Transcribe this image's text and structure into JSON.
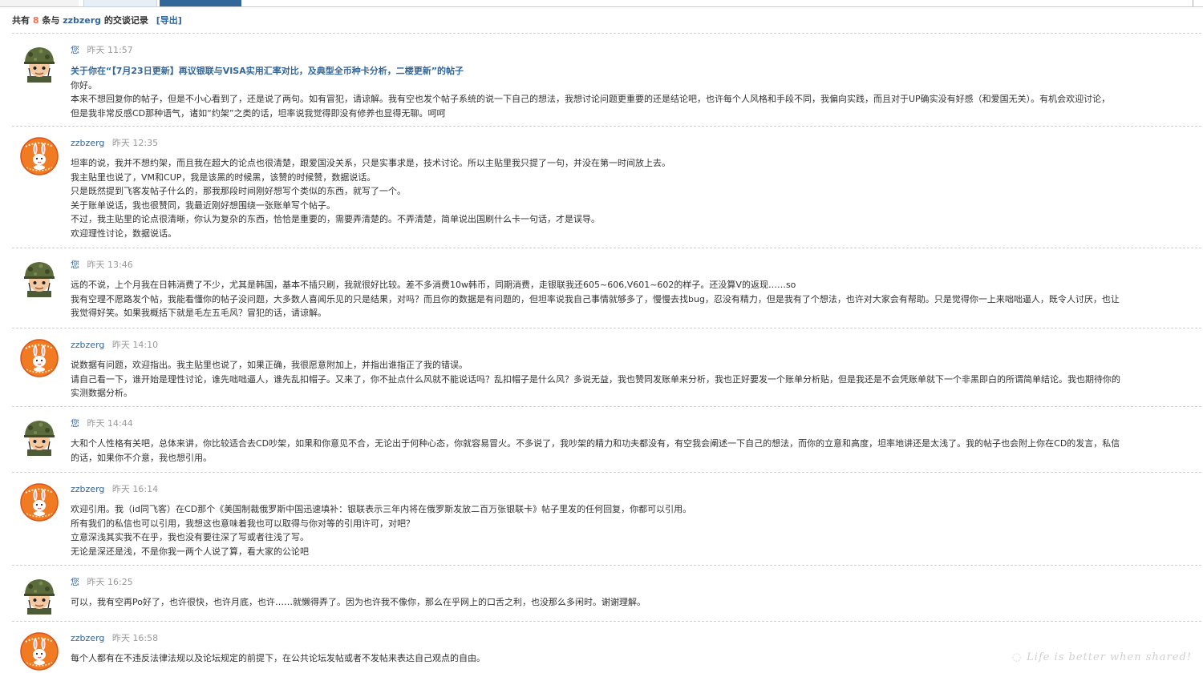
{
  "summary": {
    "prefix": "共有",
    "count": "8",
    "mid": "条与",
    "user": "zzbzerg",
    "suffix": "的交谈记录",
    "export": "[导出]"
  },
  "messages": [
    {
      "author": "您",
      "time": "昨天 11:57",
      "avatar": "soldier-avatar",
      "thread_title": "关于你在“【7月23日更新】再议银联与VISA实用汇率对比，及典型全币种卡分析，二楼更新”的帖子",
      "lines": [
        "你好。",
        "本来不想回复你的帖子，但是不小心看到了，还是说了两句。如有冒犯，请谅解。我有空也发个帖子系统的说一下自己的想法，我想讨论问题更重要的还是结论吧，也许每个人风格和手段不同，我偏向实践，而且对于UP确实没有好感（和爱国无关）。有机会欢迎讨论，",
        "但是我非常反感CD那种语气，诸如“约架”之类的话，坦率说我觉得即没有修养也显得无聊。呵呵"
      ]
    },
    {
      "author": "zzbzerg",
      "time": "昨天 12:35",
      "avatar": "rabbit-avatar",
      "lines": [
        "坦率的说，我并不想约架，而且我在超大的论点也很清楚，跟爱国没关系，只是实事求是，技术讨论。所以主贴里我只提了一句，并没在第一时间放上去。",
        "我主贴里也说了，VM和CUP，我是该黑的时候黑，该赞的时候赞，数据说话。",
        "只是既然提到飞客发帖子什么的，那我那段时间刚好想写个类似的东西，就写了一个。",
        "关于账单说话，我也很赞同，我最近刚好想围绕一张账单写个帖子。",
        "不过，我主贴里的论点很清晰，你认为复杂的东西，恰恰是重要的，需要弄清楚的。不弄清楚，简单说出国刷什么卡一句话，才是误导。",
        "欢迎理性讨论，数据说话。"
      ]
    },
    {
      "author": "您",
      "time": "昨天 13:46",
      "avatar": "soldier-avatar",
      "lines": [
        "远的不说，上个月我在日韩消费了不少，尤其是韩国，基本不插只刷，我就很好比较。差不多消费10w韩币，同期消费，走银联我还605~606,V601~602的样子。还没算V的返现……so",
        "我有空理不愿路发个帖，我能看懂你的帖子没问题，大多数人喜闻乐见的只是结果，对吗？而且你的数据是有问题的，但坦率说我自己事情就够多了，慢慢去找bug，忍没有精力，但是我有了个想法，也许对大家会有帮助。只是觉得你一上来咄咄逼人，既令人讨厌，也让",
        "我觉得好笑。如果我概括下就是毛左五毛风？冒犯的话，请谅解。"
      ]
    },
    {
      "author": "zzbzerg",
      "time": "昨天 14:10",
      "avatar": "rabbit-avatar",
      "lines": [
        "说数据有问题，欢迎指出。我主贴里也说了，如果正确，我很愿意附加上，并指出谁指正了我的错误。",
        "请自己看一下，谁开始是理性讨论，谁先咄咄逼人，谁先乱扣帽子。又来了，你不扯点什么风就不能说话吗？乱扣帽子是什么风？多说无益，我也赞同发账单来分析，我也正好要发一个账单分析贴，但是我还是不会凭账单就下一个非黑即白的所谓简单结论。我也期待你的",
        "实测数据分析。"
      ]
    },
    {
      "author": "您",
      "time": "昨天 14:44",
      "avatar": "soldier-avatar",
      "lines": [
        "大和个人性格有关吧，总体来讲，你比较适合去CD吵架，如果和你意见不合，无论出于何种心态，你就容易冒火。不多说了，我吵架的精力和功夫都没有，有空我会阐述一下自己的想法，而你的立意和高度，坦率地讲还是太浅了。我的帖子也会附上你在CD的发言，私信",
        "的话，如果你不介意，我也想引用。"
      ]
    },
    {
      "author": "zzbzerg",
      "time": "昨天 16:14",
      "avatar": "rabbit-avatar",
      "lines": [
        "欢迎引用。我（id同飞客）在CD那个《美国制裁俄罗斯中国迅速填补：银联表示三年内将在俄罗斯发放二百万张银联卡》帖子里发的任何回复，你都可以引用。",
        "所有我们的私信也可以引用，我想这也意味着我也可以取得与你对等的引用许可，对吧？",
        "立意深浅其实我不在乎，我也没有要往深了写或者往浅了写。",
        "无论是深还是浅，不是你我一两个人说了算，看大家的公论吧"
      ]
    },
    {
      "author": "您",
      "time": "昨天 16:25",
      "avatar": "soldier-avatar",
      "lines": [
        "可以，我有空再Po好了，也许很快，也许月底，也许……就懒得弄了。因为也许我不像你，那么在乎网上的口舌之利，也没那么多闲时。谢谢理解。"
      ]
    },
    {
      "author": "zzbzerg",
      "time": "昨天 16:58",
      "avatar": "rabbit-avatar",
      "lines": [
        "每个人都有在不违反法律法规以及论坛规定的前提下，在公共论坛发帖或者不发帖来表达自己观点的自由。"
      ]
    }
  ],
  "watermark": "Life is better when shared!"
}
